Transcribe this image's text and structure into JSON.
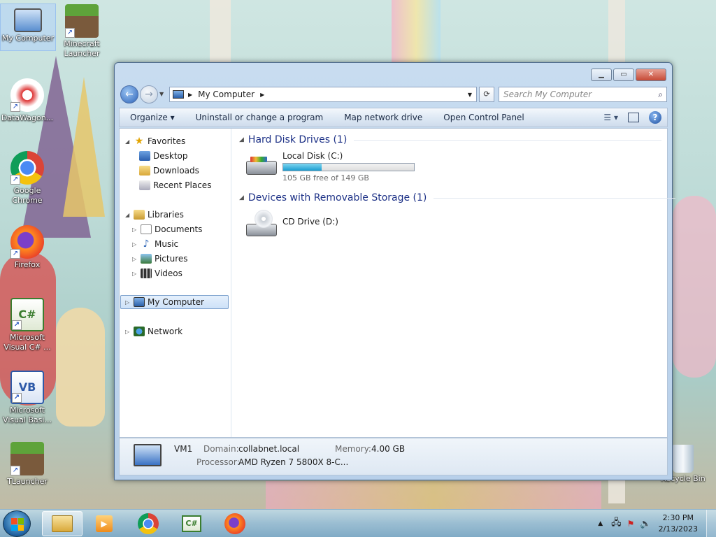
{
  "desktop": {
    "icons": [
      {
        "label": "My Computer"
      },
      {
        "label": "Minecraft Launcher"
      },
      {
        "label": "DataWagon..."
      },
      {
        "label": "Google Chrome"
      },
      {
        "label": "Firefox"
      },
      {
        "label": "Microsoft Visual C# ..."
      },
      {
        "label": "Microsoft Visual Basi..."
      },
      {
        "label": "TLauncher"
      },
      {
        "label": "Recycle Bin"
      }
    ]
  },
  "window": {
    "address": {
      "location": "My Computer"
    },
    "search": {
      "placeholder": "Search My Computer"
    },
    "toolbar": {
      "organize": "Organize",
      "uninstall": "Uninstall or change a program",
      "map_drive": "Map network drive",
      "control_panel": "Open Control Panel"
    },
    "nav": {
      "favorites": "Favorites",
      "desktop": "Desktop",
      "downloads": "Downloads",
      "recent": "Recent Places",
      "libraries": "Libraries",
      "documents": "Documents",
      "music": "Music",
      "pictures": "Pictures",
      "videos": "Videos",
      "computer": "My Computer",
      "network": "Network"
    },
    "groups": {
      "hdd": "Hard Disk Drives (1)",
      "removable": "Devices with Removable Storage (1)"
    },
    "drives": {
      "c": {
        "name": "Local Disk (C:)",
        "free": "105 GB free of 149 GB",
        "used_fraction": 0.295
      },
      "d": {
        "name": "CD Drive (D:)"
      }
    },
    "details": {
      "name": "VM1",
      "domain_label": "Domain:",
      "domain": "collabnet.local",
      "memory_label": "Memory:",
      "memory": "4.00 GB",
      "processor_label": "Processor:",
      "processor": "AMD Ryzen 7 5800X 8-C..."
    }
  },
  "taskbar": {
    "time": "2:30 PM",
    "date": "2/13/2023"
  },
  "colors": {
    "accent": "#1e3287",
    "diskbar": "#1a9dd0"
  }
}
